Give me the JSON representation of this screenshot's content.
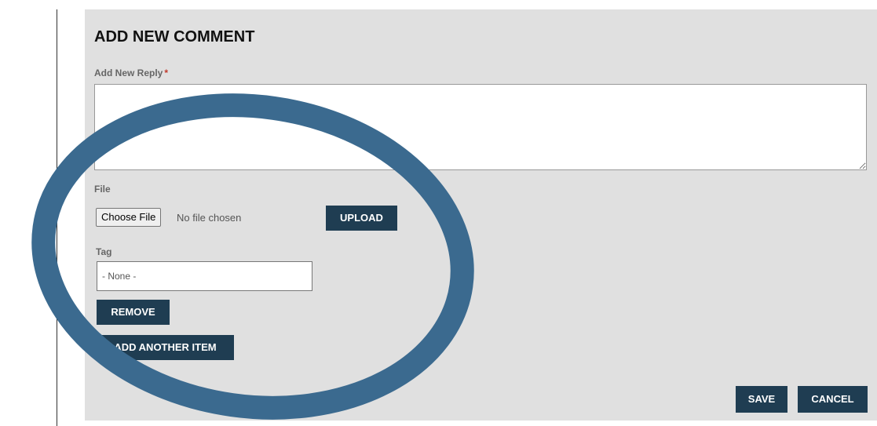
{
  "form": {
    "heading": "ADD NEW COMMENT",
    "reply_label": "Add New Reply",
    "required_marker": "*",
    "reply_value": "",
    "file_label": "File",
    "choose_file_label": "Choose File",
    "no_file_text": "No file chosen",
    "upload_label": "UPLOAD",
    "tag_label": "Tag",
    "tag_selected": "- None -",
    "remove_label": "REMOVE",
    "add_another_label": "ADD ANOTHER ITEM",
    "save_label": "SAVE",
    "cancel_label": "CANCEL"
  },
  "annotation": {
    "shape": "ellipse-outline",
    "color": "#3b6a8f"
  },
  "colors": {
    "panel_background": "#e0e0e0",
    "button_background": "#1f3d52",
    "button_text": "#ffffff",
    "required_star": "#c0392b"
  }
}
